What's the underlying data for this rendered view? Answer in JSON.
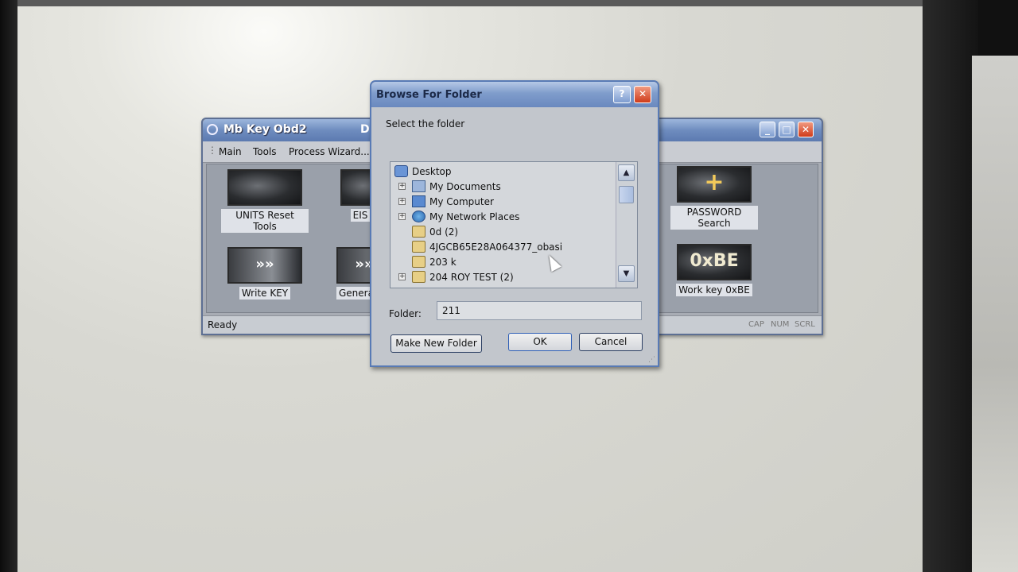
{
  "main_window": {
    "title": "Mb Key Obd2",
    "title_fragment": "D",
    "menu": [
      "Main",
      "Tools",
      "Process Wizard..."
    ],
    "tools": [
      {
        "label": "UNITS Reset Tools",
        "icon": "steering-wheel-icon"
      },
      {
        "label": "EIS",
        "icon": "ignition-lock-icon"
      },
      {
        "label": "PASSWORD Search",
        "icon": "key-plus-icon"
      },
      {
        "label": "Write KEY",
        "icon": "chip-arrow-icon"
      },
      {
        "label": "Generat",
        "icon": "chip-arrow-icon"
      },
      {
        "label": "Work key 0xBE",
        "icon": "work-key-icon",
        "thumb_text": "0xBE"
      }
    ],
    "status": "Ready",
    "indicators": [
      "CAP",
      "NUM",
      "SCRL"
    ]
  },
  "dialog": {
    "title": "Browse For Folder",
    "prompt": "Select the folder",
    "tree": [
      {
        "label": "Desktop",
        "icon": "desktop-icon",
        "expandable": false,
        "level": 0
      },
      {
        "label": "My Documents",
        "icon": "documents-icon",
        "expandable": true,
        "level": 1
      },
      {
        "label": "My Computer",
        "icon": "computer-icon",
        "expandable": true,
        "level": 1
      },
      {
        "label": "My Network Places",
        "icon": "network-icon",
        "expandable": true,
        "level": 1
      },
      {
        "label": "0d (2)",
        "icon": "folder-icon",
        "expandable": false,
        "level": 1
      },
      {
        "label": "4JGCB65E28A064377_obasi",
        "icon": "folder-icon",
        "expandable": false,
        "level": 1
      },
      {
        "label": "203 k",
        "icon": "folder-icon",
        "expandable": false,
        "level": 1
      },
      {
        "label": "204 ROY TEST (2)",
        "icon": "folder-icon",
        "expandable": true,
        "level": 1
      }
    ],
    "folder_label": "Folder:",
    "folder_value": "211",
    "make_new_folder": "Make New Folder",
    "ok": "OK",
    "cancel": "Cancel"
  }
}
